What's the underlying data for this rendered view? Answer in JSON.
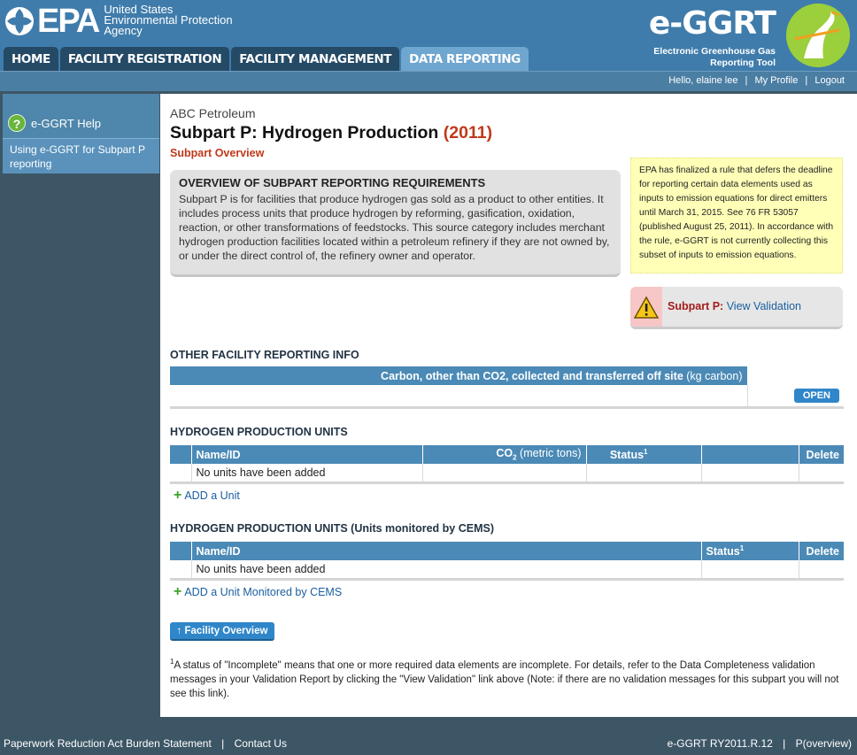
{
  "header": {
    "epa_wordmark": "EPA",
    "epa_agency_lines": [
      "United States",
      "Environmental Protection",
      "Agency"
    ],
    "app_title": "e-GGRT",
    "app_subtitle_lines": [
      "Electronic Greenhouse Gas",
      "Reporting Tool"
    ],
    "nav": [
      "HOME",
      "FACILITY REGISTRATION",
      "FACILITY MANAGEMENT",
      "DATA REPORTING"
    ],
    "active_nav": "DATA REPORTING"
  },
  "userbar": {
    "greeting": "Hello, elaine lee",
    "my_profile": "My Profile",
    "logout": "Logout"
  },
  "sidebar": {
    "help_label": "e-GGRT Help",
    "item": "Using e-GGRT for Subpart P reporting"
  },
  "main": {
    "facility": "ABC Petroleum",
    "title": "Subpart P: Hydrogen Production",
    "year": "(2011)",
    "overview_link": "Subpart Overview",
    "overview_heading": "OVERVIEW OF SUBPART REPORTING REQUIREMENTS",
    "overview_text": "Subpart P is for facilities that produce hydrogen gas sold as a product to other entities. It includes process units that produce hydrogen by reforming, gasification, oxidation, reaction, or other transformations of feedstocks. This source category includes merchant hydrogen production facilities located within a petroleum refinery if they are not owned by, or under the direct control of, the refinery owner and operator.",
    "notice": "EPA has finalized a rule that defers the deadline for reporting certain data elements used as inputs to emission equations for direct emitters until March 31, 2015. See 76 FR 53057 (published August 25, 2011). In accordance with the rule, e-GGRT is not currently collecting this subset of inputs to emission equations.",
    "validation_label": "Subpart P:",
    "validation_link": "View Validation",
    "other_info_heading": "OTHER FACILITY REPORTING INFO",
    "other_info_col": "Carbon, other than CO2, collected and transferred off site",
    "other_info_unit": "(kg carbon)",
    "open_button": "OPEN",
    "units_heading": "HYDROGEN PRODUCTION UNITS",
    "units_cols": {
      "name": "Name/ID",
      "co2": "CO",
      "co2_sub": "2",
      "co2_unit": "(metric tons)",
      "status": "Status",
      "status_sup": "1",
      "delete": "Delete"
    },
    "units_empty": "No units have been added",
    "add_unit": "ADD a Unit",
    "cems_heading": "HYDROGEN PRODUCTION UNITS (Units monitored by CEMS)",
    "cems_empty": "No units have been added",
    "add_cems_unit": "ADD a Unit Monitored by CEMS",
    "facility_overview_button": "Facility Overview",
    "footnote_sup": "1",
    "footnote": "A status of \"Incomplete\" means that one or more required data elements are incomplete. For details, refer to the Data Completeness validation messages in your Validation Report by clicking the \"View Validation\" link above (Note: if there are no validation messages for this subpart you will not see this link)."
  },
  "footer": {
    "paperwork": "Paperwork Reduction Act Burden Statement",
    "contact": "Contact Us",
    "version": "e-GGRT RY2011.R.12",
    "page_id": "P(overview)"
  },
  "colors": {
    "header_blue": "#3f7cab",
    "nav_dark": "#254a66",
    "nav_active": "#6fa6cf",
    "table_head": "#4b8ab6",
    "accent_red": "#c0391a",
    "button_blue": "#2f86c9"
  }
}
